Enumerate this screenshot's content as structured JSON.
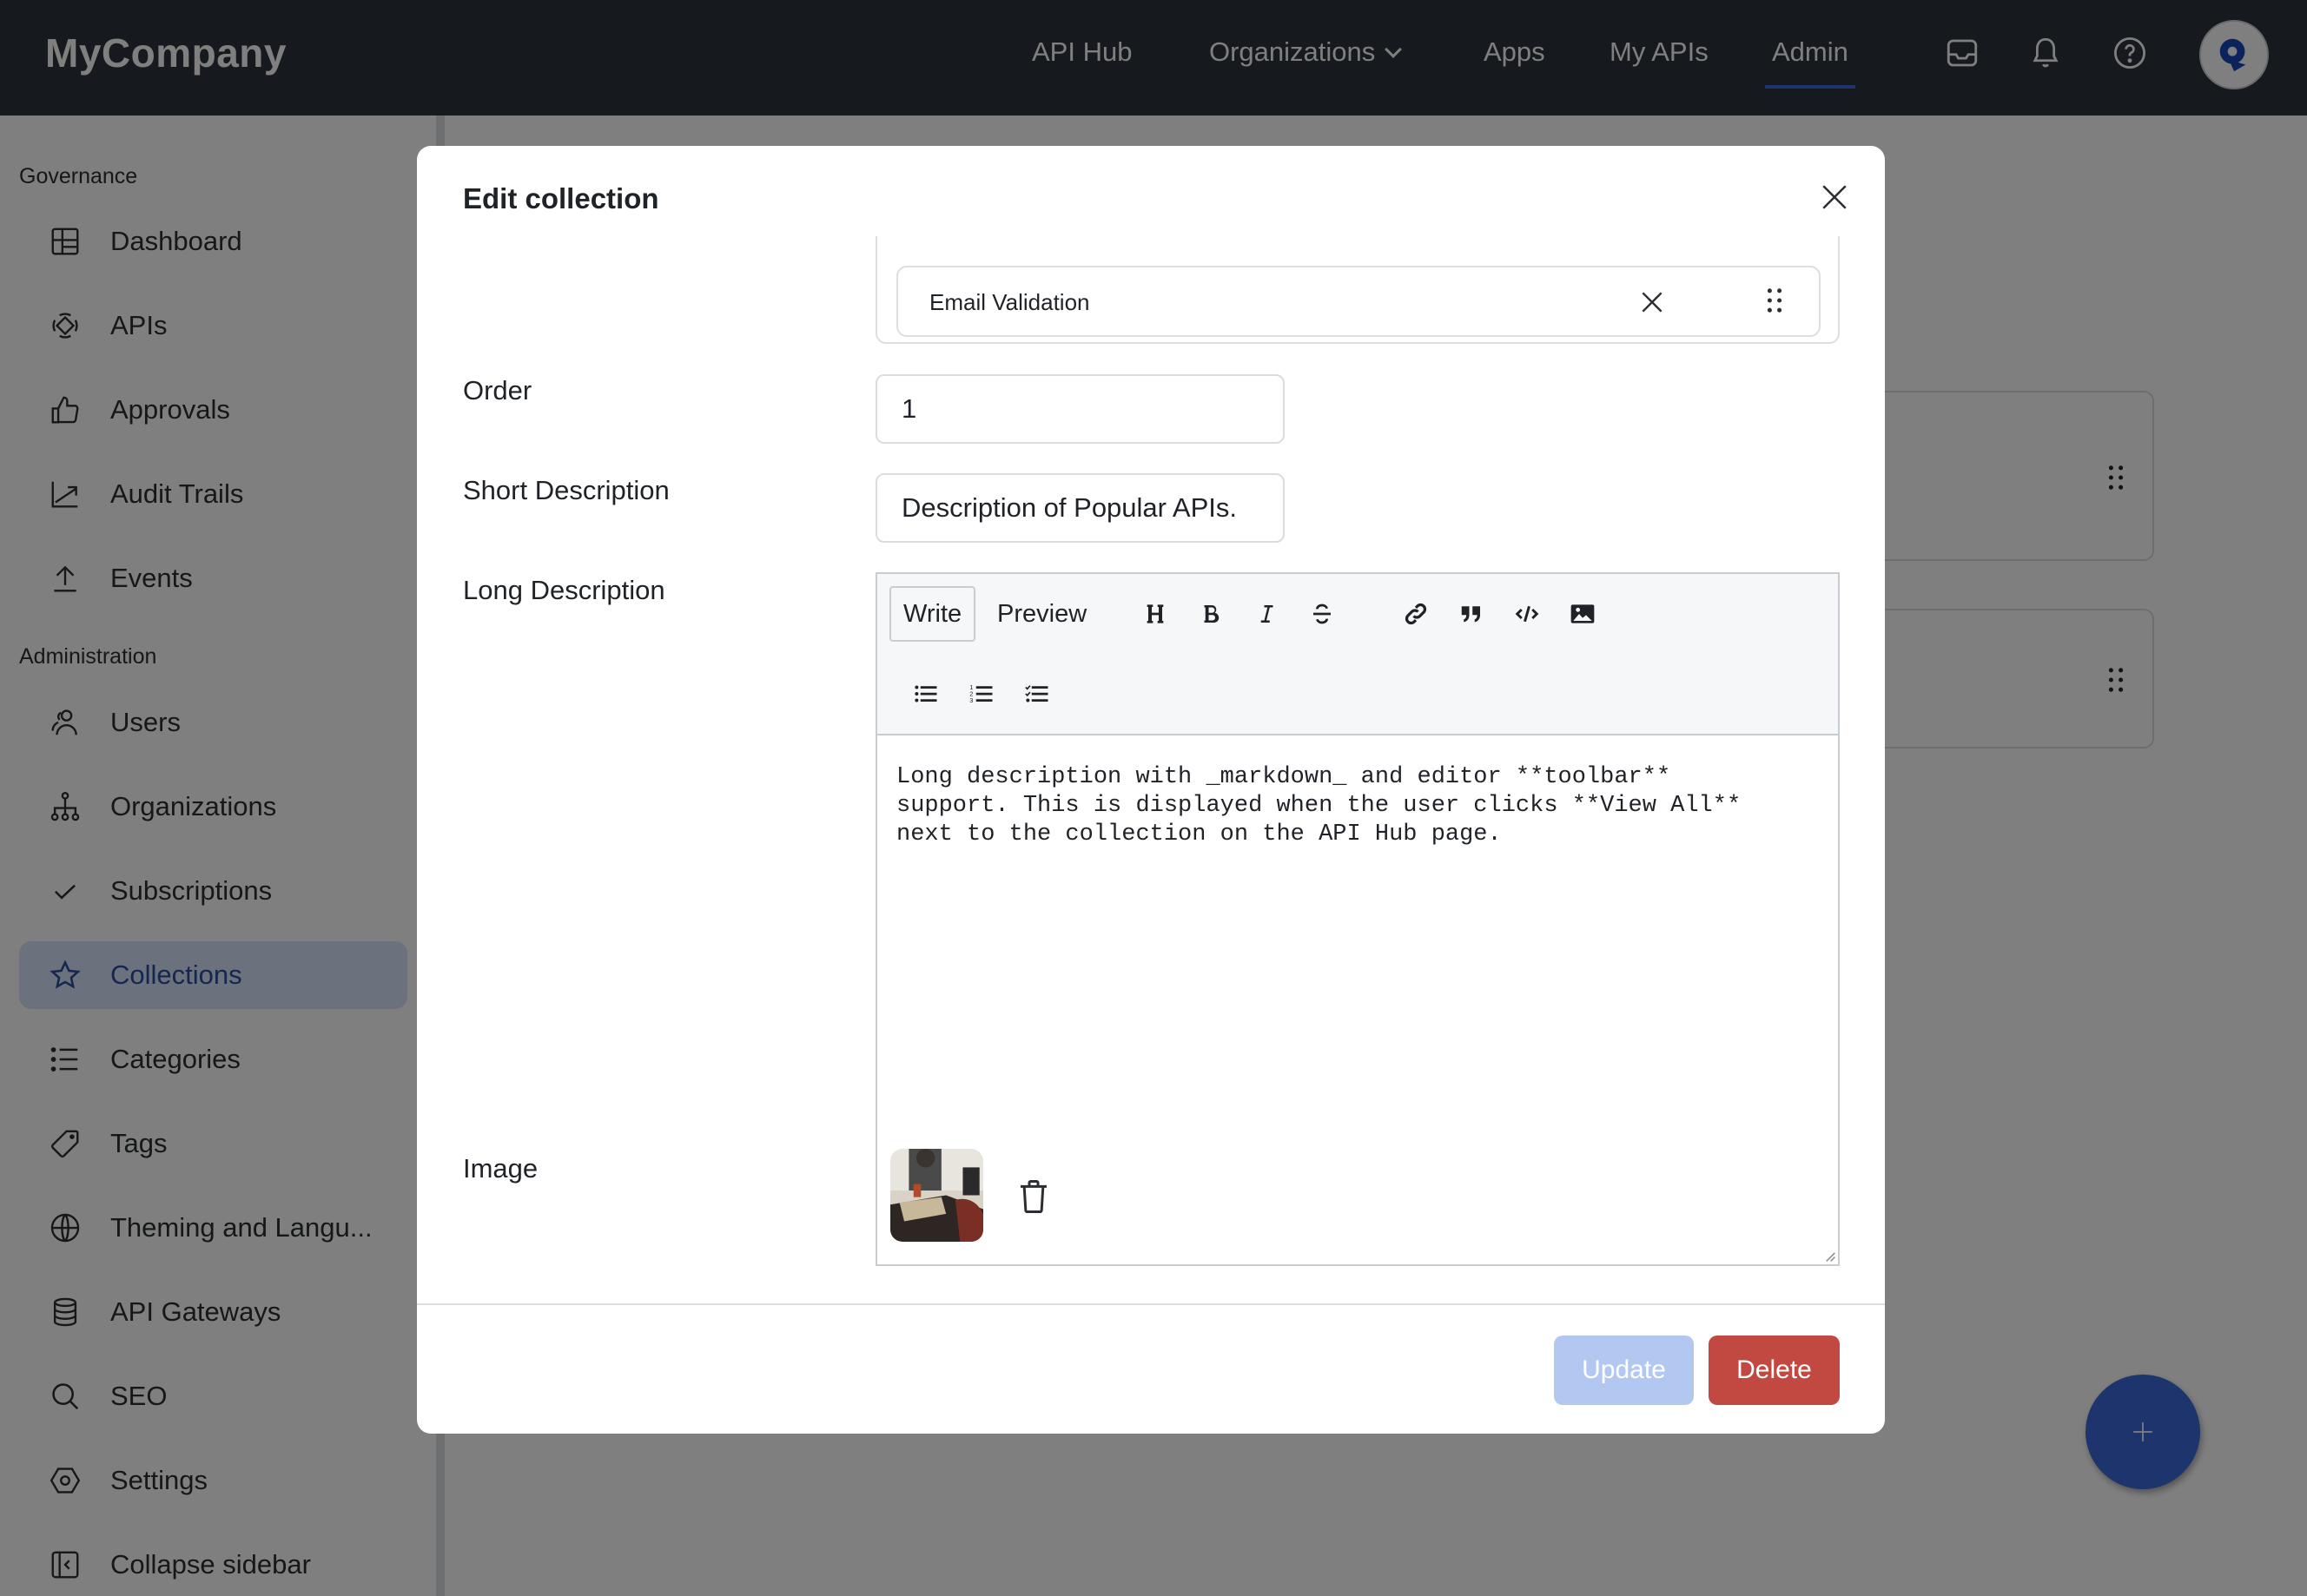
{
  "header": {
    "brand": "MyCompany",
    "nav": [
      {
        "label": "API Hub",
        "active": false
      },
      {
        "label": "Organizations",
        "active": false,
        "has_dropdown": true
      },
      {
        "label": "Apps",
        "active": false
      },
      {
        "label": "My APIs",
        "active": false
      },
      {
        "label": "Admin",
        "active": true
      }
    ],
    "icons": [
      "inbox-icon",
      "bell-icon",
      "help-icon"
    ],
    "avatar_icon": "user-avatar-logo"
  },
  "sidebar": {
    "sections": [
      {
        "label": "Governance",
        "items": [
          {
            "label": "Dashboard",
            "icon": "dashboard-icon"
          },
          {
            "label": "APIs",
            "icon": "apis-icon"
          },
          {
            "label": "Approvals",
            "icon": "thumbs-up-icon"
          },
          {
            "label": "Audit Trails",
            "icon": "chart-line-icon"
          },
          {
            "label": "Events",
            "icon": "upload-icon"
          }
        ]
      },
      {
        "label": "Administration",
        "items": [
          {
            "label": "Users",
            "icon": "users-icon"
          },
          {
            "label": "Organizations",
            "icon": "org-tree-icon"
          },
          {
            "label": "Subscriptions",
            "icon": "check-icon"
          },
          {
            "label": "Collections",
            "icon": "star-icon",
            "active": true
          },
          {
            "label": "Categories",
            "icon": "list-icon"
          },
          {
            "label": "Tags",
            "icon": "tag-icon"
          },
          {
            "label": "Theming and Langu...",
            "icon": "globe-icon"
          },
          {
            "label": "API Gateways",
            "icon": "database-icon"
          },
          {
            "label": "SEO",
            "icon": "search-icon"
          },
          {
            "label": "Settings",
            "icon": "settings-icon"
          }
        ]
      }
    ],
    "collapse_label": "Collapse sidebar"
  },
  "modal": {
    "title": "Edit collection",
    "apis_list": [
      {
        "name": "Email Validation"
      }
    ],
    "fields": {
      "order": {
        "label": "Order",
        "value": "1"
      },
      "short_description": {
        "label": "Short Description",
        "value": "Description of Popular APIs."
      },
      "long_description": {
        "label": "Long Description",
        "tabs": [
          "Write",
          "Preview"
        ],
        "active_tab": "Write",
        "toolbar": [
          "heading",
          "bold",
          "italic",
          "strikethrough",
          "link",
          "quote",
          "code",
          "image",
          "unordered-list",
          "ordered-list",
          "task-list"
        ],
        "value": "Long description with _markdown_ and editor **toolbar**\nsupport. This is displayed when the user clicks **View All**\nnext to the collection on the API Hub page."
      },
      "image": {
        "label": "Image"
      }
    },
    "buttons": {
      "update": "Update",
      "delete": "Delete"
    }
  },
  "fab_label": "+",
  "colors": {
    "accent": "#3a6ad8",
    "nav_bg": "#2c343c",
    "delete": "#c24842",
    "update_disabled": "#b3c8f1",
    "active_item_bg": "#d6e2fb"
  }
}
